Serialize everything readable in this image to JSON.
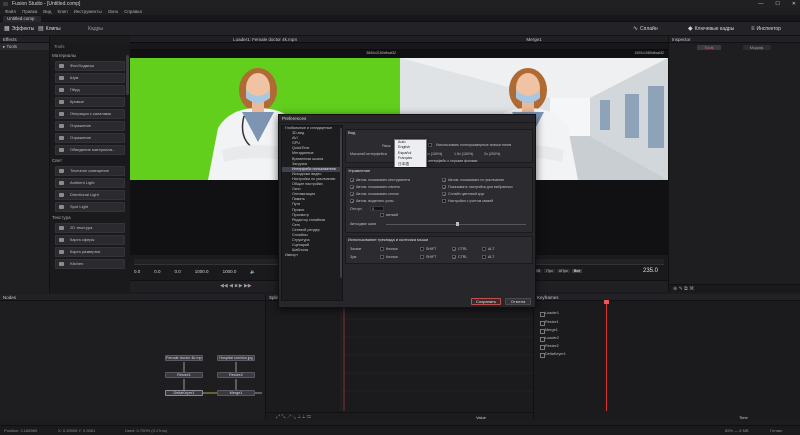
{
  "window": {
    "title": "Fusion Studio - [Untitled.comp]",
    "minimize": "—",
    "maximize": "☐",
    "close": "✕"
  },
  "menu": [
    "Файл",
    "Правка",
    "Вид",
    "Клип",
    "Инструменты",
    "Окно",
    "Справка"
  ],
  "comp_tab": "Untitled.comp",
  "toolbar": {
    "effects": "Эффекты",
    "tools": "Клипы",
    "favorites": "Кадры",
    "spline_btn": "Сплайн",
    "keyframes_btn": "Ключевые кадры",
    "inspector_btn": "Инспектор"
  },
  "effects_panel": {
    "title": "Effects",
    "items": [
      "Tools"
    ]
  },
  "tools_panel": {
    "header": "Tools",
    "categories": [
      {
        "name": "Материалы",
        "items": [
          "Фон/Ходжиш",
          "Шум",
          "Пёрд",
          "Кривые",
          "Операция с каналами",
          "Отражение",
          "Отражение",
          "Обведение материала..."
        ]
      },
      {
        "name": "Свет",
        "items": [
          "Точечное освещение",
          "Ambient Light",
          "Directional Light",
          "Spot Light"
        ]
      },
      {
        "name": "Текстура",
        "items": [
          "2D текстура",
          "Карта сферы",
          "Карта развертки",
          "Kitchen"
        ]
      }
    ]
  },
  "viewer_left": {
    "title": "Loader1: Female doctor 4k.mp4",
    "resolution": "3840x2160xfloat32"
  },
  "viewer_right": {
    "title": "Merge1",
    "resolution": "1920x1080xfloat32"
  },
  "inspector": {
    "title": "Inspector",
    "tab_tools": "Tools",
    "tab_modifiers": "Модиф."
  },
  "timeline": {
    "start": "0.0",
    "render_start": "0.0",
    "current": "0.0",
    "render_end": "1000.0",
    "end": "1000.0",
    "frame": "235.0",
    "btn_hiq": "HiQ",
    "btn_mb": "MB",
    "btn_prx": "Прк",
    "btn_aprx": "АПрк",
    "btn_some": "Все"
  },
  "nodes": {
    "title": "Nodes",
    "loader": "Female doctor 4k.mp4",
    "loader2": "Hospital corridor.jpg",
    "blur": "Resize1",
    "resize2": "Resize2",
    "delta": "DeltaKeyer1",
    "merge": "Merge1"
  },
  "spline": {
    "title": "Spline",
    "value_label": "Value"
  },
  "keyframes": {
    "title": "Keyframes",
    "rows": [
      "Loader1",
      "Resize1",
      "Merge1",
      "Loader2",
      "Resize2",
      "DeltaKeyer1"
    ],
    "time_label": "Time"
  },
  "status": {
    "left": "Position: 0.168989",
    "coords": "X: 0.30906  Y: 0.3061",
    "mem": "Used: 0.700% (0.17ms)",
    "right": "65% — 8 MB",
    "idle": "Готово"
  },
  "preferences": {
    "title": "Preferences",
    "list": [
      {
        "label": "Глобальные и стандартные",
        "top": true
      },
      {
        "label": "3D-вид"
      },
      {
        "label": "AVI"
      },
      {
        "label": "GPU"
      },
      {
        "label": "QuickTime"
      },
      {
        "label": "Метаданные"
      },
      {
        "label": "Временная шкала"
      },
      {
        "label": "Загрузка"
      },
      {
        "label": "Интерфейс пользователя",
        "sel": true
      },
      {
        "label": "Исходники видео"
      },
      {
        "label": "Настройки по умолчанию"
      },
      {
        "label": "Общие настройки"
      },
      {
        "label": "Окно"
      },
      {
        "label": "Оптимизация"
      },
      {
        "label": "Память"
      },
      {
        "label": "Пути"
      },
      {
        "label": "Прокси"
      },
      {
        "label": "Просмотр"
      },
      {
        "label": "Редактор сплайнов"
      },
      {
        "label": "Сеть"
      },
      {
        "label": "Сетевой рендер"
      },
      {
        "label": "Сплайны"
      },
      {
        "label": "Структура"
      },
      {
        "label": "Сценарий"
      },
      {
        "label": "Шаблоны"
      },
      {
        "label": "Импорт"
      }
    ],
    "view_section": {
      "title": "Вид",
      "lang_label": "Язык",
      "lang_value": "Auto",
      "scale_label": "Масштаб интерфейса",
      "opt_native": "Использовать полноразмерные значки типов",
      "opt_100": "1x (100%)",
      "opt_150": "1.5x (150%)",
      "opt_200": "2x (200%)",
      "opt_font": "интерфейс с серыми фонами"
    },
    "language_popup": [
      "Auto",
      "English",
      "Español",
      "Français",
      "日本語",
      "Português",
      "Русский",
      "Việt",
      "简体中文"
    ],
    "language_selected": "Русский",
    "control_section": {
      "title": "Управление",
      "left": [
        "Автом. показывать инструменты",
        "Автом. показывать панель",
        "Автом. показывать ключи",
        "Автом. выделять узлы"
      ],
      "right": [
        "Автом. показывать по умолчанию",
        "Показывать настройки для выбранных",
        "Сплайн цветовой круг",
        "Настройки с учетом связей"
      ],
      "group_label": "Отступ",
      "group_value": "0",
      "checkbox_extra": "мелкий",
      "slider_label": "Автосдвиг шага"
    },
    "mouse_section": {
      "title": "Использование трекпада и колесика мыши",
      "rows": [
        {
          "label": "Захват",
          "mods": [
            "Кнопка",
            "SHIFT",
            "CTRL",
            "ALT"
          ]
        },
        {
          "label": "Зум",
          "mods": [
            "Кнопка",
            "SHIFT",
            "CTRL",
            "ALT"
          ]
        }
      ]
    },
    "save": "Сохранить",
    "cancel": "Отмена"
  }
}
